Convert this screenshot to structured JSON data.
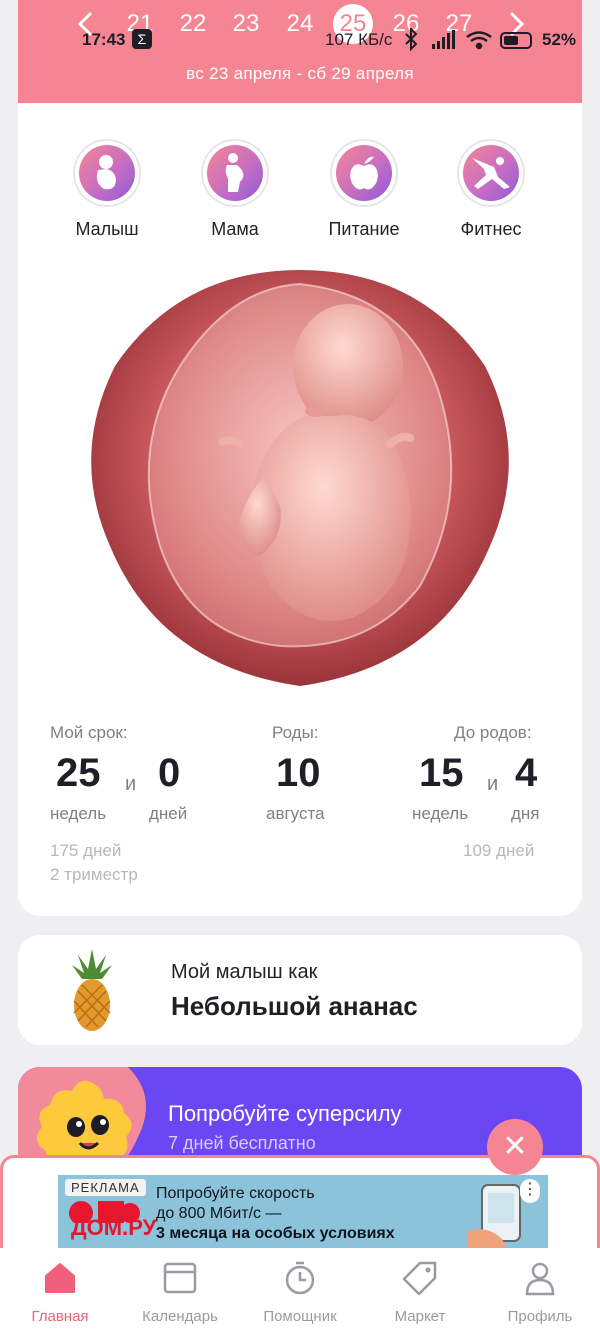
{
  "status_bar": {
    "time": "17:43",
    "sigma": "Σ",
    "speed": "107 КБ/с",
    "battery": "52%"
  },
  "week_selector": {
    "days": [
      "21",
      "22",
      "23",
      "24",
      "25",
      "26",
      "27"
    ],
    "selected_day": "25",
    "week_range": "вс 23 апреля - сб 29 апреля"
  },
  "categories": [
    {
      "label": "Малыш",
      "icon": "baby-icon"
    },
    {
      "label": "Мама",
      "icon": "pregnant-mom-icon"
    },
    {
      "label": "Питание",
      "icon": "apple-icon"
    },
    {
      "label": "Фитнес",
      "icon": "yoga-icon"
    }
  ],
  "term": {
    "label": "Мой срок:",
    "weeks": "25",
    "and": "и",
    "days": "0",
    "weeks_unit": "недель",
    "days_unit": "дней",
    "total_days": "175 дней",
    "trimester": "2 триместр"
  },
  "birth": {
    "label": "Роды:",
    "day": "10",
    "month": "августа"
  },
  "until_birth": {
    "label": "До родов:",
    "weeks": "15",
    "and": "и",
    "days": "4",
    "weeks_unit": "недель",
    "days_unit": "дня",
    "total_days": "109 дней"
  },
  "baby_size": {
    "subtitle": "Мой малыш как",
    "title": "Небольшой ананас"
  },
  "promo": {
    "title": "Попробуйте суперсилу",
    "subtitle": "7 дней бесплатно",
    "close": "✕"
  },
  "ad": {
    "tag": "РЕКЛАМА",
    "brand": "ДОМ.РУ",
    "line1": "Попробуйте скорость",
    "line2": "до 800 Мбит/с —",
    "line3": "3 месяца на особых условиях",
    "menu": "⋮"
  },
  "bottom_nav": [
    {
      "label": "Главная",
      "icon": "home-icon",
      "active": true
    },
    {
      "label": "Календарь",
      "icon": "calendar-icon",
      "active": false
    },
    {
      "label": "Помощник",
      "icon": "timer-icon",
      "active": false
    },
    {
      "label": "Маркет",
      "icon": "tag-icon",
      "active": false
    },
    {
      "label": "Профиль",
      "icon": "profile-icon",
      "active": false
    }
  ],
  "colors": {
    "accent": "#f68594",
    "promo": "#6b46f3",
    "nav_active": "#f0607a"
  }
}
